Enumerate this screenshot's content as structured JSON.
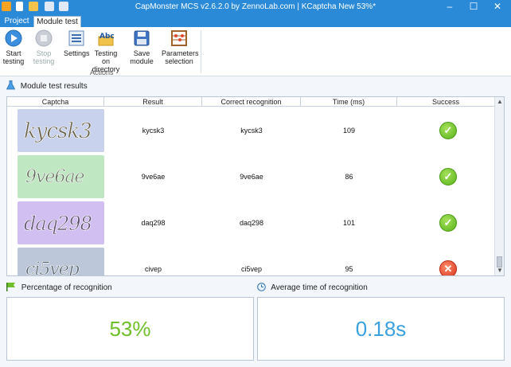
{
  "window": {
    "title": "CapMonster MCS v2.6.2.0 by ZennoLab.com | KCaptcha New 53%*",
    "controls": {
      "minimize": "–",
      "maximize": "☐",
      "close": "✕"
    }
  },
  "tabs": [
    {
      "label": "Project"
    },
    {
      "label": "Module test"
    }
  ],
  "ribbon": {
    "buttons": [
      {
        "label": "Start testing",
        "icon": "play-icon"
      },
      {
        "label": "Stop testing",
        "icon": "stop-icon"
      },
      {
        "label": "Settings",
        "icon": "settings-icon"
      },
      {
        "label": "Testing on directory",
        "icon": "abc-folder-icon"
      },
      {
        "label": "Save module",
        "icon": "save-icon"
      },
      {
        "label": "Parameters selection",
        "icon": "abacus-icon"
      }
    ],
    "group_label": "Actions"
  },
  "results": {
    "section_title": "Module test results",
    "columns": [
      "Captcha",
      "Result",
      "Correct recognition",
      "Time (ms)",
      "Success"
    ],
    "rows": [
      {
        "captcha_text": "kycsk3",
        "result": "kycsk3",
        "correct": "kycsk3",
        "time_ms": "109",
        "success": true,
        "bg": "#c8d2ec"
      },
      {
        "captcha_text": "9ve6ae",
        "result": "9ve6ae",
        "correct": "9ve6ae",
        "time_ms": "86",
        "success": true,
        "bg": "#bfe8c2"
      },
      {
        "captcha_text": "daq298",
        "result": "daq298",
        "correct": "daq298",
        "time_ms": "101",
        "success": true,
        "bg": "#d2bff2"
      },
      {
        "captcha_text": "ci5vep",
        "result": "civep",
        "correct": "ci5vep",
        "time_ms": "95",
        "success": false,
        "bg": "#bcc7d9"
      }
    ]
  },
  "stats": {
    "percentage_label": "Percentage of recognition",
    "percentage_value": "53%",
    "average_label": "Average time of recognition",
    "average_value": "0.18s"
  },
  "colors": {
    "titlebar": "#2b8ad8",
    "percentage": "#6fbf2b",
    "average": "#3aa0df"
  }
}
